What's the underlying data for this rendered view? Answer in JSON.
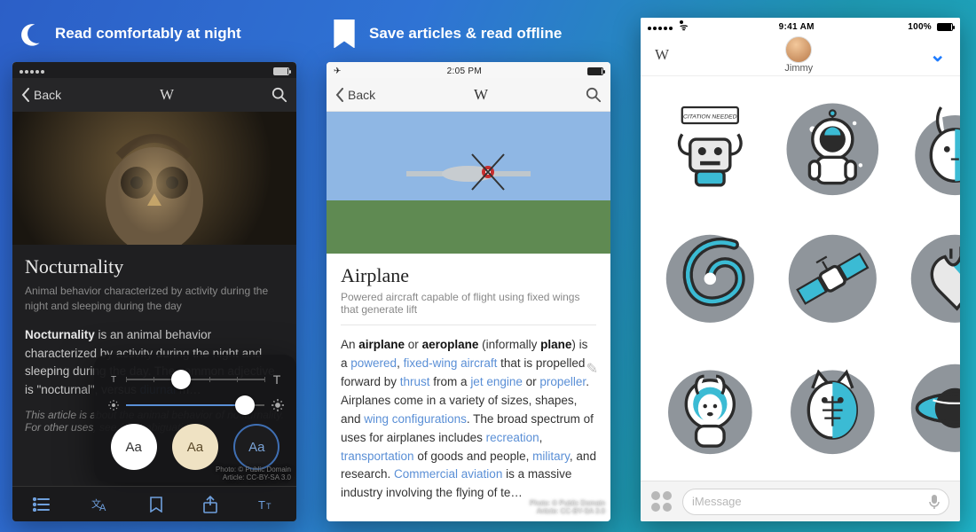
{
  "panel1": {
    "promo": "Read comfortably at night",
    "back": "Back",
    "article": {
      "title": "Nocturnality",
      "summary": "Animal behavior characterized by activity during the night and sleeping during the day",
      "para_lead": "Nocturnality",
      "para_rest_1": " is an animal behavior characterized by activity during the night and sleeping during the day. The common adjective is \"nocturnal\", versus ",
      "link_diurnal": "diurnal",
      "para_rest_2": " m…",
      "italic": "This article is about the animal behavior of nocturnality. For other uses, see (disambiguation)."
    },
    "popover": {
      "size_small": "T",
      "size_large": "T",
      "theme_label": "Aa"
    },
    "credit_line1": "Photo: © Public Domain",
    "credit_line2": "Article: CC-BY-SA 3.0"
  },
  "panel2": {
    "promo": "Save articles & read offline",
    "back": "Back",
    "time": "2:05 PM",
    "article": {
      "title": "Airplane",
      "summary": "Powered aircraft capable of flight using fixed wings that generate lift",
      "p_an": "An ",
      "b_airplane": "airplane",
      "p_or": " or ",
      "b_aeroplane": "aeroplane",
      "p_inf": " (informally ",
      "b_plane": "plane",
      "p_isa": ") is a ",
      "l_powered": "powered",
      "p_comma": ", ",
      "l_fixedwing": "fixed-wing aircraft",
      "p_thrustby": " that is propelled forward by ",
      "l_thrust": "thrust",
      "p_froma": " from a ",
      "l_jetengine": "jet engine",
      "p_or2": " or ",
      "l_propeller": "propeller",
      "p_variety": ". Airplanes come in a variety of sizes, shapes, and ",
      "l_wingconfig": "wing configurations",
      "p_broad": ". The broad spectrum of uses for airplanes includes ",
      "l_recreation": "recreation",
      "p_comma2": ", ",
      "l_transport": "transportation",
      "p_goods": " of goods and people, ",
      "l_military": "military",
      "p_research": ", and research. ",
      "l_commav": "Commercial aviation",
      "p_tail": " is a massive industry involving the flying of te…"
    },
    "credit_line1": "Photo: © Public Domain",
    "credit_line2": "Article: CC-BY-SA 3.0"
  },
  "panel3": {
    "status_time": "9:41 AM",
    "status_batt": "100%",
    "contact": "Jimmy",
    "input_placeholder": "iMessage",
    "sticker_names": [
      "citation-needed-robot",
      "astronaut",
      "rabbit",
      "spiral-galaxy",
      "satellite",
      "anatomical-heart",
      "space-dog",
      "xray-cat",
      "black-hole"
    ],
    "citation_label": "CITATION NEEDED"
  }
}
